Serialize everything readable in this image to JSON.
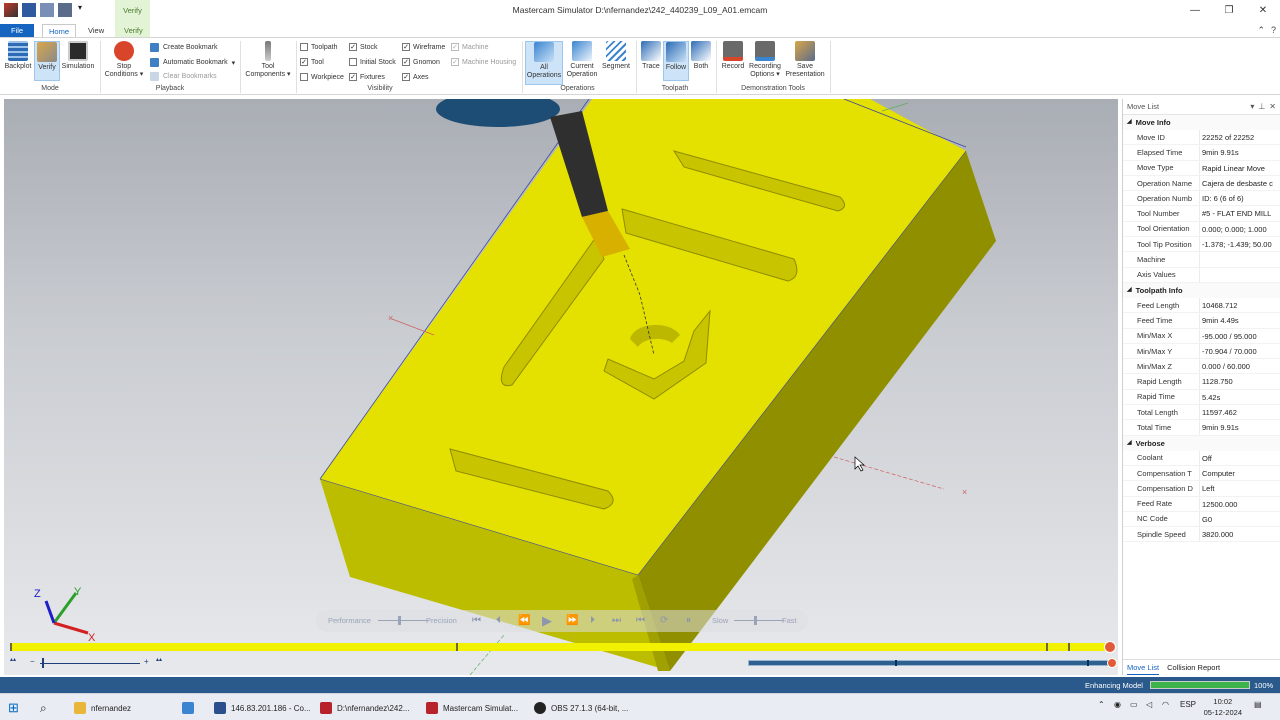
{
  "window": {
    "title": "Mastercam Simulator  D:\\nfernandez\\242_440239_L09_A01.emcam",
    "context_tab_group": "Verify",
    "controls": [
      "—",
      "❐",
      "✕"
    ]
  },
  "tabs": [
    "File",
    "Home",
    "View",
    "Verify"
  ],
  "ribbon": {
    "mode": {
      "label": "Mode",
      "buttons": [
        "Backplot",
        "Verify",
        "Simulation"
      ]
    },
    "playback": {
      "label": "Playback",
      "stop": "Stop Conditions",
      "cmds": [
        "Create Bookmark",
        "Automatic Bookmark",
        "Clear Bookmarks"
      ]
    },
    "tool_components": "Tool Components",
    "visibility": {
      "label": "Visibility",
      "items": [
        {
          "label": "Toolpath",
          "checked": false
        },
        {
          "label": "Tool",
          "checked": true
        },
        {
          "label": "Workpiece",
          "checked": false
        },
        {
          "label": "Stock",
          "checked": true
        },
        {
          "label": "Initial Stock",
          "checked": false
        },
        {
          "label": "Fixtures",
          "checked": true
        },
        {
          "label": "Wireframe",
          "checked": true
        },
        {
          "label": "Gnomon",
          "checked": true
        },
        {
          "label": "Axes",
          "checked": true
        },
        {
          "label": "Machine",
          "checked": true,
          "disabled": true
        },
        {
          "label": "Machine Housing",
          "checked": true,
          "disabled": true
        }
      ]
    },
    "operations": {
      "label": "Operations",
      "buttons": [
        "All Operations",
        "Current Operation",
        "Segment"
      ]
    },
    "toolpath": {
      "label": "Toolpath",
      "buttons": [
        "Trace",
        "Follow",
        "Both"
      ]
    },
    "demo": {
      "label": "Demonstration Tools",
      "buttons": [
        "Record",
        "Recording Options",
        "Save Presentation"
      ]
    }
  },
  "playback_bar": {
    "left": "Performance",
    "mid": "Precision",
    "slow": "Slow",
    "fast": "Fast"
  },
  "zoom": {
    "minus": "−",
    "plus": "+"
  },
  "panel": {
    "title": "Move List",
    "sections": [
      {
        "name": "Move Info",
        "rows": [
          [
            "Move ID",
            "22252 of 22252"
          ],
          [
            "Elapsed Time",
            "9min 9.91s"
          ],
          [
            "Move Type",
            "Rapid Linear Move"
          ],
          [
            "Operation Name",
            "Cajera de desbaste c"
          ],
          [
            "Operation Numb",
            "ID: 6 (6 of 6)"
          ],
          [
            "Tool Number",
            "#5 - FLAT END MILL"
          ],
          [
            "Tool Orientation",
            "0.000; 0.000; 1.000"
          ],
          [
            "Tool Tip Position",
            "-1.378; -1.439; 50.00"
          ],
          [
            "Machine",
            ""
          ],
          [
            "Axis Values",
            ""
          ]
        ]
      },
      {
        "name": "Toolpath Info",
        "rows": [
          [
            "Feed Length",
            "10468.712"
          ],
          [
            "Feed Time",
            "9min 4.49s"
          ],
          [
            "Min/Max X",
            "-95.000 / 95.000"
          ],
          [
            "Min/Max Y",
            "-70.904 / 70.000"
          ],
          [
            "Min/Max Z",
            "0.000 / 60.000"
          ],
          [
            "Rapid Length",
            "1128.750"
          ],
          [
            "Rapid Time",
            "5.42s"
          ],
          [
            "Total Length",
            "11597.462"
          ],
          [
            "Total Time",
            "9min 9.91s"
          ]
        ]
      },
      {
        "name": "Verbose",
        "rows": [
          [
            "Coolant",
            "Off"
          ],
          [
            "Compensation T",
            "Computer"
          ],
          [
            "Compensation D",
            "Left"
          ],
          [
            "Feed Rate",
            "12500.000"
          ],
          [
            "NC Code",
            "G0"
          ],
          [
            "Spindle Speed",
            "3820.000"
          ]
        ]
      }
    ],
    "tabs": [
      "Move List",
      "Collision Report"
    ]
  },
  "status": {
    "text": "Enhancing Model",
    "percent": "100%",
    "progress": 1.0
  },
  "taskbar": {
    "apps": [
      "nfernandez",
      "146.83.201.186 - Co...",
      "D:\\nfernandez\\242...",
      "Mastercam Simulat...",
      "OBS 27.1.3 (64-bit, ..."
    ],
    "lang": "ESP",
    "time": "10:02",
    "date": "05-12-2024"
  },
  "gnomon": {
    "x": "X",
    "y": "Y",
    "z": "Z"
  },
  "colors": {
    "stock": "#e4e000",
    "accent": "#1565c0",
    "status": "#2a5a8c"
  }
}
